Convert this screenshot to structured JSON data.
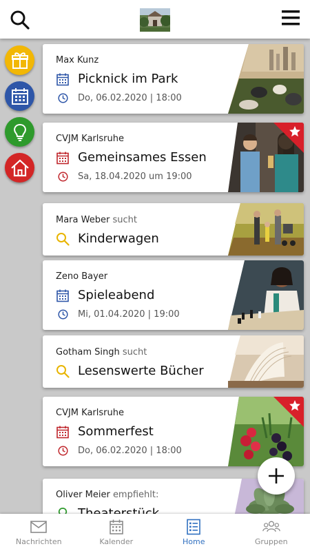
{
  "header": {
    "search_icon": "search-icon",
    "logo_alt": "house-photo-logo",
    "menu_icon": "hamburger-menu-icon"
  },
  "sidebar": {
    "items": [
      {
        "icon": "gift-icon",
        "color": "#f2b705"
      },
      {
        "icon": "calendar-icon",
        "color": "#2e56a8"
      },
      {
        "icon": "lightbulb-icon",
        "color": "#2e9a2c"
      },
      {
        "icon": "home-icon",
        "color": "#d32626"
      }
    ]
  },
  "feed": {
    "cards": [
      {
        "author": "Max Kunz",
        "verb": "",
        "type": "event",
        "title": "Picknick im Park",
        "date": "Do, 06.02.2020 | 18:00",
        "starred": false
      },
      {
        "author": "CVJM Karlsruhe",
        "verb": "",
        "type": "event",
        "title": "Gemeinsames Essen",
        "date": "Sa, 18.04.2020 um 19:00",
        "starred": true
      },
      {
        "author": "Mara Weber",
        "verb": "sucht",
        "type": "search",
        "title": "Kinderwagen",
        "date": "",
        "starred": false
      },
      {
        "author": "Zeno Bayer",
        "verb": "",
        "type": "event",
        "title": "Spieleabend",
        "date": "Mi, 01.04.2020 | 19:00",
        "starred": false
      },
      {
        "author": "Gotham Singh",
        "verb": "sucht",
        "type": "search",
        "title": "Lesenswerte Bücher",
        "date": "",
        "starred": false
      },
      {
        "author": "CVJM Karlsruhe",
        "verb": "",
        "type": "event",
        "title": "Sommerfest",
        "date": "Do, 06.02.2020 | 18:00",
        "starred": true
      },
      {
        "author": "Oliver Meier",
        "verb": "empfiehlt:",
        "type": "recommend",
        "title": "Theaterstück",
        "date": "",
        "starred": false
      }
    ]
  },
  "fab": {
    "icon": "plus-icon"
  },
  "bottom_nav": {
    "items": [
      {
        "label": "Nachrichten",
        "icon": "mail-icon",
        "active": false
      },
      {
        "label": "Kalender",
        "icon": "calendar-icon",
        "active": false
      },
      {
        "label": "Home",
        "icon": "list-icon",
        "active": true
      },
      {
        "label": "Gruppen",
        "icon": "group-icon",
        "active": false
      }
    ]
  },
  "colors": {
    "accent_blue": "#2f6fc0",
    "event_blue": "#2e56a8",
    "event_red": "#c0272d",
    "search_yellow": "#e8b400",
    "ribbon_red": "#d8202a"
  }
}
